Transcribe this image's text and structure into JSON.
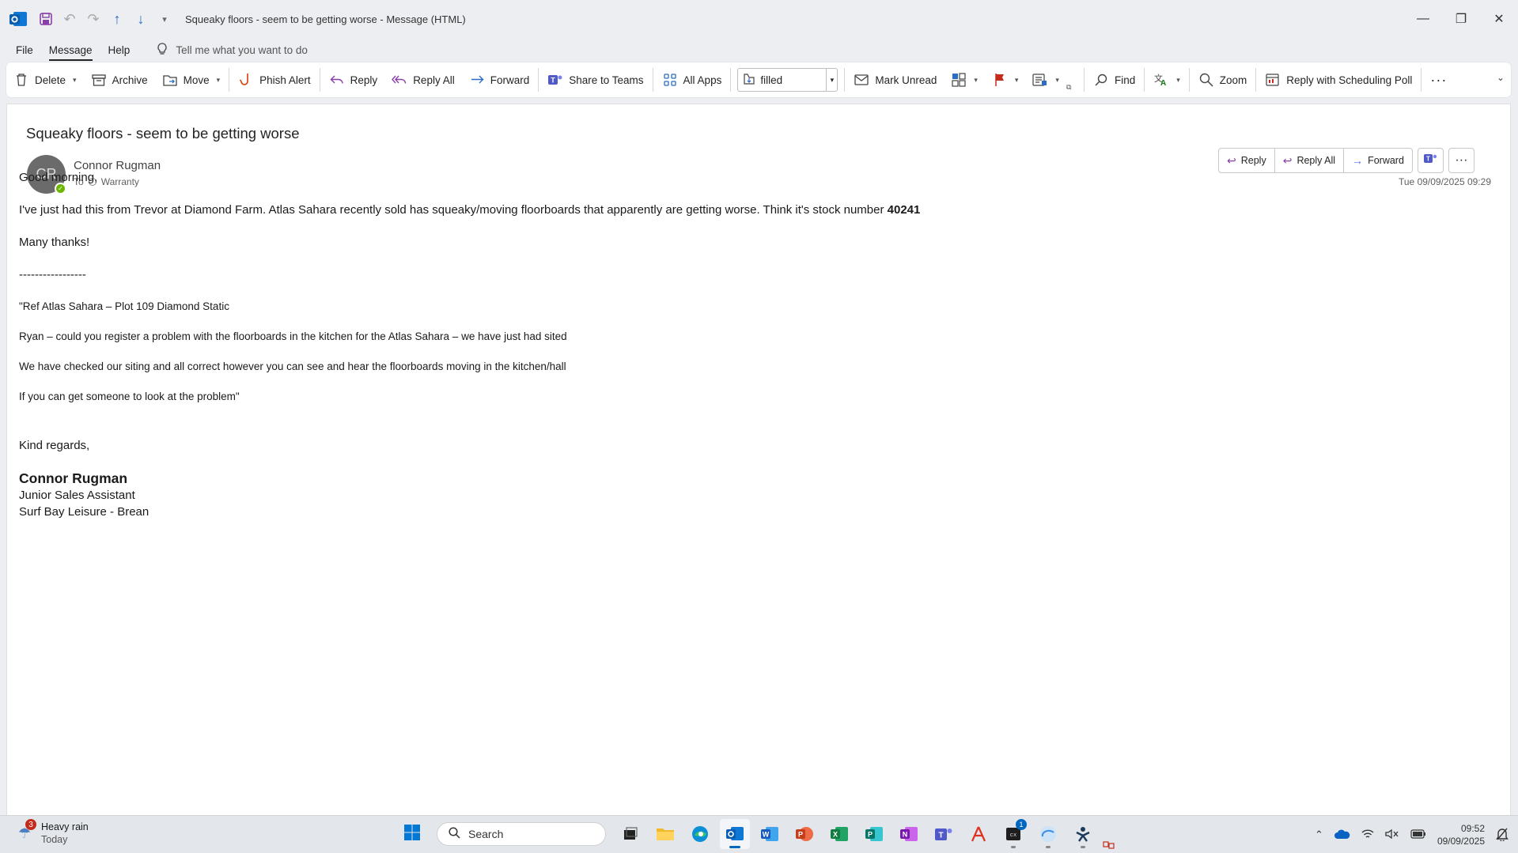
{
  "window": {
    "title": "Squeaky floors - seem to be getting worse  -  Message (HTML)"
  },
  "menu": {
    "file": "File",
    "message": "Message",
    "help": "Help",
    "tell_me": "Tell me what you want to do"
  },
  "ribbon": {
    "delete": "Delete",
    "archive": "Archive",
    "move": "Move",
    "phish_alert": "Phish Alert",
    "reply": "Reply",
    "reply_all": "Reply All",
    "forward": "Forward",
    "share_to_teams": "Share to Teams",
    "all_apps": "All Apps",
    "quick_step_value": "filled",
    "mark_unread": "Mark Unread",
    "find": "Find",
    "zoom": "Zoom",
    "reply_scheduling_poll": "Reply with Scheduling Poll"
  },
  "message": {
    "subject": "Squeaky floors - seem to be getting worse",
    "sender_initials": "CR",
    "sender_name": "Connor Rugman",
    "to_label": "To",
    "recipient": "Warranty",
    "date": "Tue 09/09/2025 09:29",
    "actions": {
      "reply": "Reply",
      "reply_all": "Reply All",
      "forward": "Forward"
    },
    "body": {
      "greeting": "Good morning,",
      "line1": "I've just had this from Trevor at Diamond Farm. Atlas Sahara recently sold has squeaky/moving floorboards that apparently are getting worse. Think it's stock number ",
      "stock_number": "40241",
      "thanks": "Many thanks!",
      "divider": "-----------------",
      "quote1": "\"Ref Atlas Sahara – Plot 109 Diamond Static",
      "quote2": "Ryan – could you register a problem with the floorboards in the kitchen for the Atlas Sahara – we have just had sited",
      "quote3": "We have checked our siting and all correct however you can see and hear the floorboards moving in the kitchen/hall",
      "quote4": "If you can get someone to look at the problem\"",
      "regards": "Kind regards,",
      "sig_name": "Connor Rugman",
      "sig_title": "Junior Sales Assistant",
      "sig_company": "Surf Bay Leisure - Brean"
    }
  },
  "taskbar": {
    "weather_badge": "3",
    "weather_text": "Heavy rain",
    "weather_sub": "Today",
    "search_placeholder": "Search",
    "app_badge": "1",
    "time": "09:52",
    "date": "09/09/2025"
  },
  "colors": {
    "accent": "#0067c0",
    "ribbon_bg": "#ffffff",
    "chrome_bg": "#eceef1",
    "presence_available": "#6bb700"
  }
}
